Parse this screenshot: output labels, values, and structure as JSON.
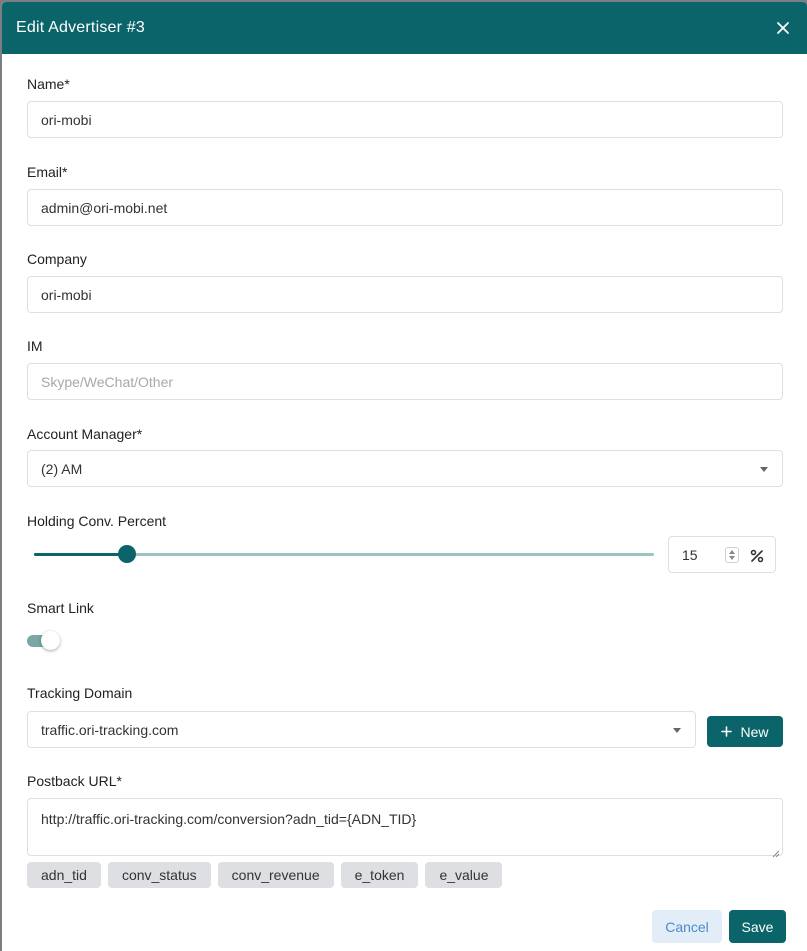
{
  "modal": {
    "title": "Edit Advertiser #3",
    "close_icon": "close-icon"
  },
  "form": {
    "name": {
      "label": "Name*",
      "value": "ori-mobi"
    },
    "email": {
      "label": "Email*",
      "value": "admin@ori-mobi.net"
    },
    "company": {
      "label": "Company",
      "value": "ori-mobi"
    },
    "im": {
      "label": "IM",
      "value": "",
      "placeholder": "Skype/WeChat/Other"
    },
    "account_manager": {
      "label": "Account Manager*",
      "value": "(2) AM"
    },
    "holding": {
      "label": "Holding Conv. Percent",
      "value": "15",
      "slider_fraction": 0.15
    },
    "smart_link": {
      "label": "Smart Link",
      "enabled": true
    },
    "tracking_domain": {
      "label": "Tracking Domain",
      "value": "traffic.ori-tracking.com",
      "new_label": "New"
    },
    "postback": {
      "label": "Postback URL*",
      "value": "http://traffic.ori-tracking.com/conversion?adn_tid={ADN_TID}",
      "macros": [
        "adn_tid",
        "conv_status",
        "conv_revenue",
        "e_token",
        "e_value"
      ]
    }
  },
  "footer": {
    "cancel_label": "Cancel",
    "save_label": "Save"
  },
  "colors": {
    "primary": "#0a6469",
    "slider_track": "#9ac5c3",
    "cancel_bg": "#e3edf7",
    "cancel_text": "#4a8ccf"
  }
}
